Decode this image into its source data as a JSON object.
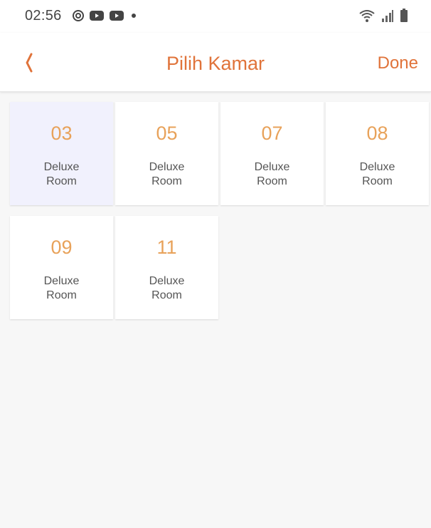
{
  "status_bar": {
    "time": "02:56",
    "left_icons": [
      "sync-icon",
      "youtube-icon",
      "youtube-icon",
      "dot-icon"
    ],
    "right_icons": [
      "wifi-icon",
      "signal-icon",
      "battery-icon"
    ]
  },
  "header": {
    "title": "Pilih Kamar",
    "done_label": "Done",
    "back_icon": "chevron-left-icon"
  },
  "colors": {
    "accent": "#e0733a",
    "room_number": "#e8a25a",
    "selected_bg": "#f1f1fd"
  },
  "rooms": [
    {
      "number": "03",
      "type_line1": "Deluxe",
      "type_line2": "Room",
      "selected": true
    },
    {
      "number": "05",
      "type_line1": "Deluxe",
      "type_line2": "Room",
      "selected": false
    },
    {
      "number": "07",
      "type_line1": "Deluxe",
      "type_line2": "Room",
      "selected": false
    },
    {
      "number": "08",
      "type_line1": "Deluxe",
      "type_line2": "Room",
      "selected": false
    },
    {
      "number": "09",
      "type_line1": "Deluxe",
      "type_line2": "Room",
      "selected": false
    },
    {
      "number": "11",
      "type_line1": "Deluxe",
      "type_line2": "Room",
      "selected": false
    }
  ]
}
